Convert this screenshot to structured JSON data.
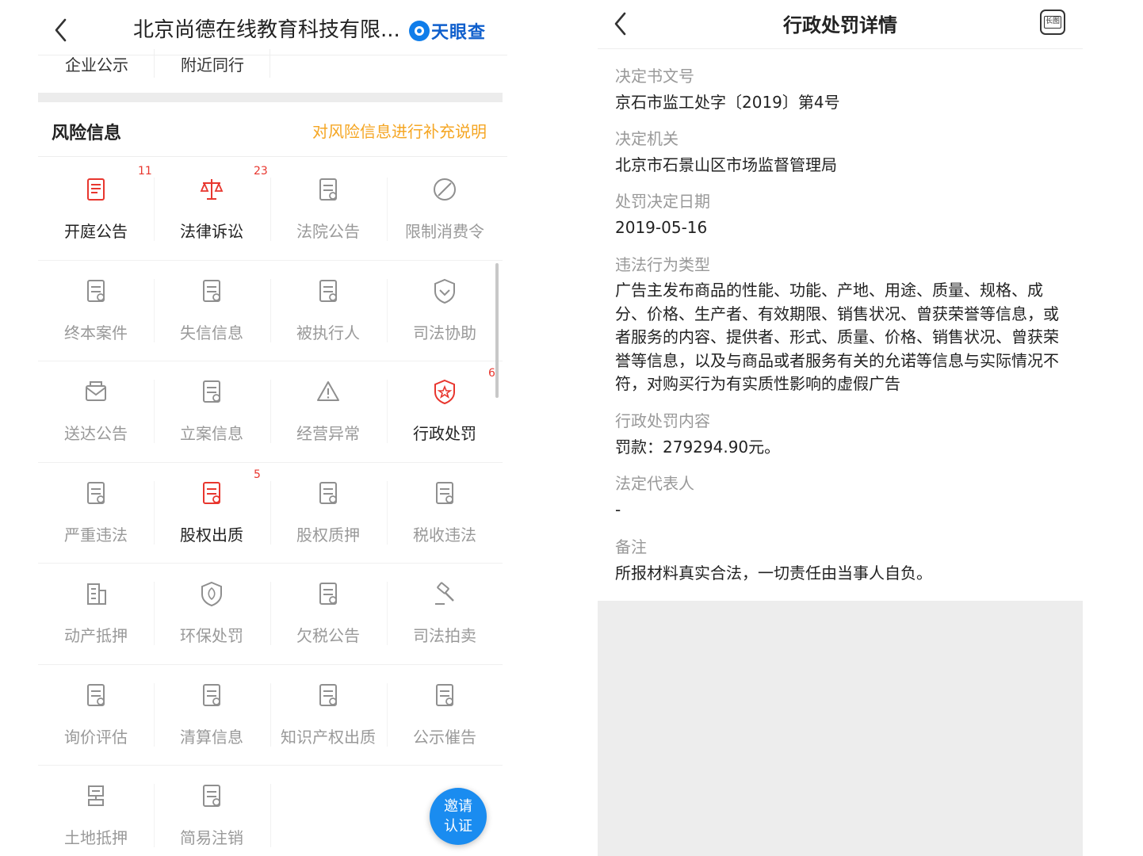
{
  "left": {
    "header": {
      "title": "北京尚德在线教育科技有限...",
      "logo_text": "天眼查"
    },
    "quick_tabs": [
      "企业公示",
      "附近同行"
    ],
    "risk": {
      "title": "风险信息",
      "link": "对风险信息进行补充说明"
    },
    "grid": [
      {
        "label": "开庭公告",
        "count": "11",
        "icon": "court-notice-icon",
        "active": true
      },
      {
        "label": "法律诉讼",
        "count": "23",
        "icon": "scale-icon",
        "active": true
      },
      {
        "label": "法院公告",
        "count": "",
        "icon": "court-announcement-icon",
        "active": false
      },
      {
        "label": "限制消费令",
        "count": "",
        "icon": "no-consumption-icon",
        "active": false
      },
      {
        "label": "终本案件",
        "count": "",
        "icon": "case-closed-icon",
        "active": false
      },
      {
        "label": "失信信息",
        "count": "",
        "icon": "id-card-icon",
        "active": false
      },
      {
        "label": "被执行人",
        "count": "",
        "icon": "bank-search-icon",
        "active": false
      },
      {
        "label": "司法协助",
        "count": "",
        "icon": "shield-heart-icon",
        "active": false
      },
      {
        "label": "送达公告",
        "count": "",
        "icon": "envelope-icon",
        "active": false
      },
      {
        "label": "立案信息",
        "count": "",
        "icon": "filing-icon",
        "active": false
      },
      {
        "label": "经营异常",
        "count": "",
        "icon": "warning-icon",
        "active": false
      },
      {
        "label": "行政处罚",
        "count": "6",
        "icon": "star-badge-icon",
        "active": true
      },
      {
        "label": "严重违法",
        "count": "",
        "icon": "violation-icon",
        "active": false
      },
      {
        "label": "股权出质",
        "count": "5",
        "icon": "equity-pledge-icon",
        "active": true
      },
      {
        "label": "股权质押",
        "count": "",
        "icon": "stock-pledge-icon",
        "active": false
      },
      {
        "label": "税收违法",
        "count": "",
        "icon": "tax-violation-icon",
        "active": false
      },
      {
        "label": "动产抵押",
        "count": "",
        "icon": "building-icon",
        "active": false
      },
      {
        "label": "环保处罚",
        "count": "",
        "icon": "leaf-shield-icon",
        "active": false
      },
      {
        "label": "欠税公告",
        "count": "",
        "icon": "tax-owed-icon",
        "active": false
      },
      {
        "label": "司法拍卖",
        "count": "",
        "icon": "gavel-icon",
        "active": false
      },
      {
        "label": "询价评估",
        "count": "",
        "icon": "price-search-icon",
        "active": false
      },
      {
        "label": "清算信息",
        "count": "",
        "icon": "liquidation-icon",
        "active": false
      },
      {
        "label": "知识产权出质",
        "count": "",
        "icon": "ip-pledge-icon",
        "active": false
      },
      {
        "label": "公示催告",
        "count": "",
        "icon": "clipboard-icon",
        "active": false
      },
      {
        "label": "土地抵押",
        "count": "",
        "icon": "land-icon",
        "active": false
      },
      {
        "label": "简易注销",
        "count": "",
        "icon": "deregister-icon",
        "active": false
      }
    ],
    "invite": {
      "line1": "邀请",
      "line2": "认证"
    }
  },
  "right": {
    "title": "行政处罚详情",
    "long_image_label": "长图",
    "fields": [
      {
        "label": "决定书文号",
        "value": "京石市监工处字〔2019〕第4号"
      },
      {
        "label": "决定机关",
        "value": "北京市石景山区市场监督管理局"
      },
      {
        "label": "处罚决定日期",
        "value": "2019-05-16"
      },
      {
        "label": "违法行为类型",
        "value": "广告主发布商品的性能、功能、产地、用途、质量、规格、成分、价格、生产者、有效期限、销售状况、曾获荣誉等信息，或者服务的内容、提供者、形式、质量、价格、销售状况、曾获荣誉等信息，以及与商品或者服务有关的允诺等信息与实际情况不符，对购买行为有实质性影响的虚假广告"
      },
      {
        "label": "行政处罚内容",
        "value": "罚款：279294.90元。"
      },
      {
        "label": "法定代表人",
        "value": "-"
      },
      {
        "label": "备注",
        "value": "所报材料真实合法，一切责任由当事人自负。"
      }
    ]
  },
  "colors": {
    "accent": "#f5a623",
    "alert": "#e8362e",
    "brand": "#0f7dea"
  }
}
